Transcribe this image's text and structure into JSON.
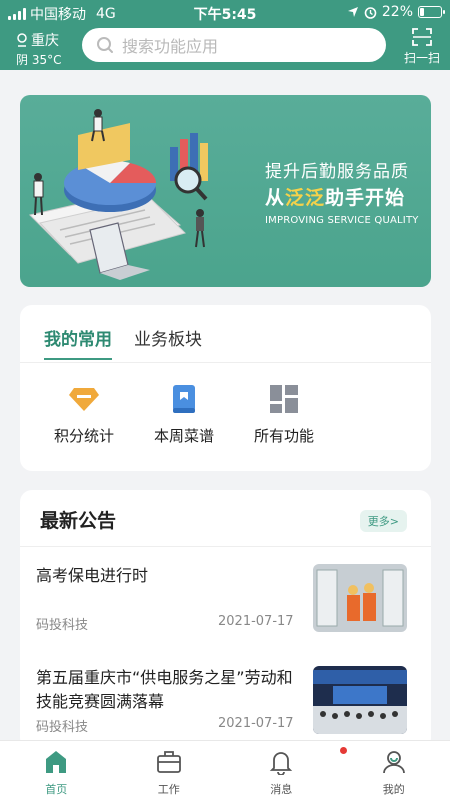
{
  "status_bar": {
    "carrier": "中国移动",
    "network": "4G",
    "time": "下午5:45",
    "battery": "22%",
    "battery_level": 0.22
  },
  "header": {
    "city": "重庆",
    "weather": "阴 35°C",
    "search_placeholder": "搜索功能应用",
    "scan_label": "扫一扫"
  },
  "banner": {
    "line1": "提升后勤服务品质",
    "line2_prefix": "从",
    "line2_highlight": "泛泛",
    "line2_suffix": "助手开始",
    "line3": "IMPROVING SERVICE QUALITY"
  },
  "common": {
    "tabs": [
      {
        "label": "我的常用"
      },
      {
        "label": "业务板块"
      }
    ],
    "apps": [
      {
        "label": "积分统计",
        "icon": "diamond-icon"
      },
      {
        "label": "本周菜谱",
        "icon": "book-icon"
      },
      {
        "label": "所有功能",
        "icon": "grid-icon"
      }
    ]
  },
  "announcements": {
    "title": "最新公告",
    "more_label": "更多>",
    "items": [
      {
        "title": "高考保电进行时",
        "source": "码投科技",
        "date": "2021-07-17"
      },
      {
        "title": "第五届重庆市“供电服务之星”劳动和技能竞赛圆满落幕",
        "source": "码投科技",
        "date": "2021-07-17"
      }
    ]
  },
  "tabbar": [
    {
      "label": "首页",
      "icon": "home-icon"
    },
    {
      "label": "工作",
      "icon": "briefcase-icon"
    },
    {
      "label": "消息",
      "icon": "bell-icon"
    },
    {
      "label": "我的",
      "icon": "user-icon"
    }
  ],
  "colors": {
    "primary": "#3e9a82",
    "highlight": "#f5d24b",
    "badge": "#e53935"
  }
}
